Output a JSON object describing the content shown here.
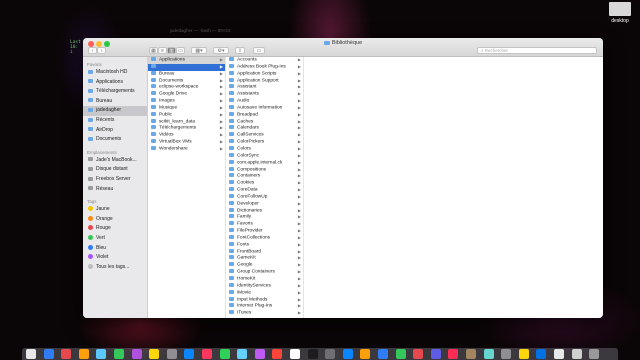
{
  "desktop": {
    "icon_label": "desktop",
    "terminal_lines": [
      "Last",
      "10:",
      "i"
    ],
    "ghost_title": "jadedagher — -bash — 80×24"
  },
  "window": {
    "title": "Bibliothèque",
    "search_placeholder": "Rechercher",
    "toolbar_icons": [
      "chevron-left-icon",
      "chevron-right-icon",
      "view-icons",
      "view-list",
      "view-columns",
      "view-gallery",
      "group-icon",
      "gear-icon",
      "share-icon",
      "tag-icon"
    ]
  },
  "sidebar": {
    "sections": [
      {
        "title": "Favoris",
        "items": [
          {
            "label": "Macintosh HD",
            "icon": "drive-icon"
          },
          {
            "label": "Applications",
            "icon": "applications-icon"
          },
          {
            "label": "Téléchargements",
            "icon": "downloads-icon"
          },
          {
            "label": "Bureau",
            "icon": "desktop-icon"
          },
          {
            "label": "jadedagher",
            "icon": "home-icon",
            "selected": true
          },
          {
            "label": "Récents",
            "icon": "clock-icon"
          },
          {
            "label": "AirDrop",
            "icon": "airdrop-icon"
          },
          {
            "label": "Documents",
            "icon": "documents-icon"
          }
        ]
      },
      {
        "title": "Emplacements",
        "items": [
          {
            "label": "Jade's MacBook...",
            "icon": "laptop-icon"
          },
          {
            "label": "Disque distant",
            "icon": "disc-icon"
          },
          {
            "label": "Freebox Server",
            "icon": "server-icon"
          },
          {
            "label": "Réseau",
            "icon": "network-icon"
          }
        ]
      },
      {
        "title": "Tags",
        "items": [
          {
            "label": "Jaune",
            "color": "#f5c400"
          },
          {
            "label": "Orange",
            "color": "#f58a16"
          },
          {
            "label": "Rouge",
            "color": "#e5484d"
          },
          {
            "label": "Vert",
            "color": "#34c759"
          },
          {
            "label": "Bleu",
            "color": "#2f7cf6"
          },
          {
            "label": "Violet",
            "color": "#a855f7"
          },
          {
            "label": "Tous les tags...",
            "color": "#bdbdbd"
          }
        ]
      }
    ]
  },
  "columns": {
    "col1": [
      {
        "label": "Applications",
        "sel": "light"
      },
      {
        "label": "",
        "sel": "blue"
      },
      {
        "label": "Bureau"
      },
      {
        "label": "Documents"
      },
      {
        "label": "eclipse-workspace"
      },
      {
        "label": "Google Drive"
      },
      {
        "label": "Images"
      },
      {
        "label": "Musique"
      },
      {
        "label": "Public"
      },
      {
        "label": "scikit_learn_data"
      },
      {
        "label": "Téléchargements"
      },
      {
        "label": "Vidéos"
      },
      {
        "label": "VirtualBox VMs"
      },
      {
        "label": "Wondershare"
      }
    ],
    "col2": [
      "Accounts",
      "Address Book Plug-Ins",
      "Application Scripts",
      "Application Support",
      "Assistant",
      "Assistants",
      "Audio",
      "Autosave Information",
      "Breadpad",
      "Caches",
      "Calendars",
      "CallServices",
      "ColorPickers",
      "Colors",
      "ColorSync",
      "com.apple.internal.ck",
      "Compositions",
      "Containers",
      "Cookies",
      "CoreData",
      "CoreFollowUp",
      "Developer",
      "Dictionaries",
      "Family",
      "Favoris",
      "FileProvider",
      "FontCollections",
      "Fonts",
      "FrontBoard",
      "GameKit",
      "Google",
      "Group Containers",
      "HomeKit",
      "IdentityServices",
      "iMovie",
      "Input Methods",
      "Internet Plug-Ins",
      "iTunes"
    ]
  },
  "dock": {
    "icon_colors": [
      "#e8e8e8",
      "#2f7cf6",
      "#e5484d",
      "#ff9f0a",
      "#5ac8fa",
      "#34c759",
      "#af52de",
      "#ffd60a",
      "#8e8e93",
      "#0a84ff",
      "#ff375f",
      "#30d158",
      "#64d2ff",
      "#bf5af2",
      "#ff453a",
      "#ffffff",
      "#1c1c1e",
      "#6e6e73",
      "#0a84ff",
      "#ff9f0a",
      "#2f7cf6",
      "#34c759",
      "#e5484d",
      "#5e5ce6",
      "#ff2d55",
      "#a2845e",
      "#66d4cf",
      "#8e8e93",
      "#ffd60a",
      "#0071e3",
      "#e8e8e8",
      "#d0d0d0",
      "#999999"
    ]
  }
}
